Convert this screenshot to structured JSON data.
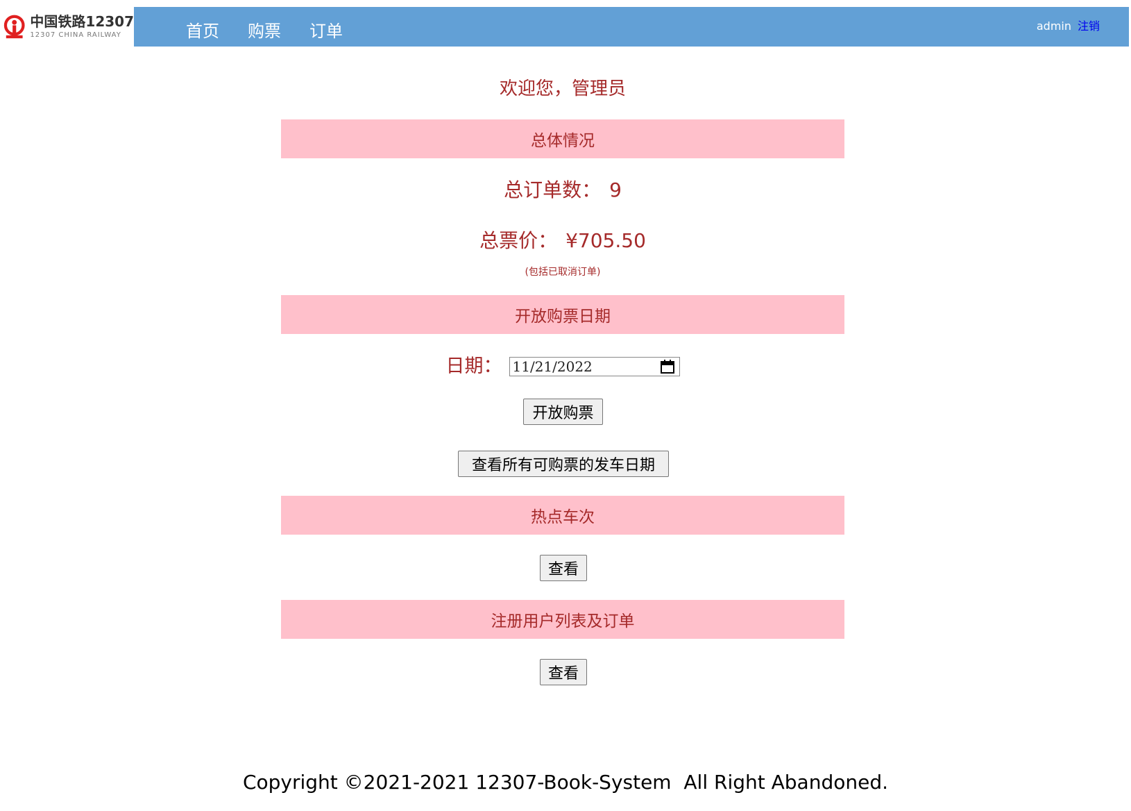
{
  "header": {
    "logo": {
      "cn_text": "中国铁路12307",
      "en_text": "12307 CHINA RAILWAY",
      "icon": "railway-logo-icon"
    },
    "nav": [
      {
        "label": "首页"
      },
      {
        "label": "购票"
      },
      {
        "label": "订单"
      }
    ],
    "user": {
      "name": "admin",
      "logout_label": "注销"
    },
    "colors": {
      "navbar": "#62a0d6",
      "logo_red": "#e02020"
    }
  },
  "main": {
    "welcome": "欢迎您，管理员",
    "sections": {
      "overview": "总体情况",
      "open_sale": "开放购票日期",
      "hot_trains": "热点车次",
      "users": "注册用户列表及订单"
    },
    "stats": {
      "orders_label": "总订单数：",
      "orders_value": "9",
      "price_label": "总票价：",
      "price_value": "¥705.50",
      "note": "(包括已取消订单)"
    },
    "date_form": {
      "label": "日期：",
      "value": "11/21/2022",
      "calendar_icon": "calendar-icon"
    },
    "buttons": {
      "open_sale": "开放购票",
      "view_dates": "查看所有可购票的发车日期",
      "view_hot": "查看",
      "view_users": "查看"
    },
    "colors": {
      "text": "#a52a2a",
      "section_bar": "#ffc0cb"
    }
  },
  "footer": {
    "text": "Copyright ©2021-2021 12307-Book-System  All Right Abandoned."
  }
}
